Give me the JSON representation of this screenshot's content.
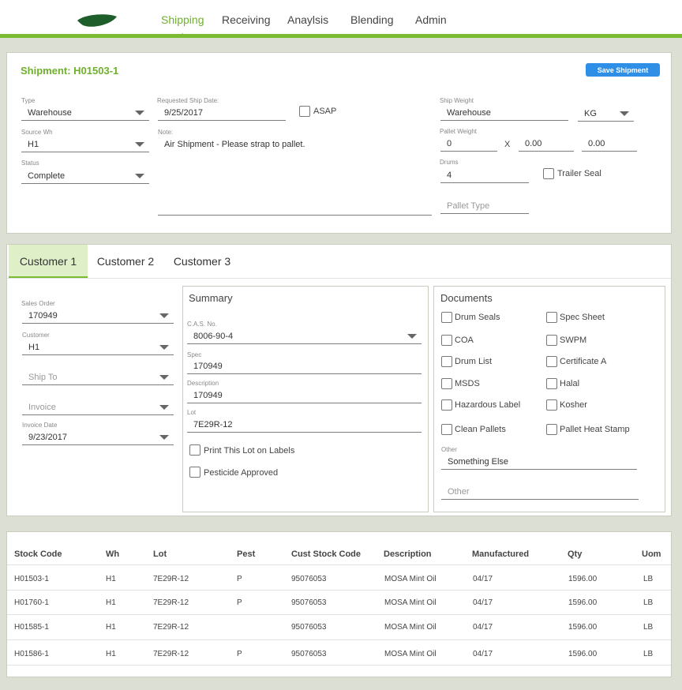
{
  "nav": {
    "items": [
      "Shipping",
      "Receiving",
      "Anaylsis",
      "Blending",
      "Admin"
    ],
    "active": "Shipping"
  },
  "shipment": {
    "title": "Shipment: H01503-1",
    "save_label": "Save Shipment",
    "type": {
      "label": "Type",
      "value": "Warehouse"
    },
    "source_wh": {
      "label": "Source Wh",
      "value": "H1"
    },
    "status": {
      "label": "Status",
      "value": "Complete"
    },
    "requested_ship_date": {
      "label": "Requested Ship Date:",
      "value": "9/25/2017"
    },
    "asap_label": "ASAP",
    "note": {
      "label": "Note:",
      "value": "Air Shipment - Please strap to pallet."
    },
    "ship_weight": {
      "label": "Ship Weight",
      "value": "Warehouse",
      "unit": "KG"
    },
    "pallet_weight": {
      "label": "Pallet Weight",
      "value": "0",
      "x_sep": "X",
      "dim1": "0.00",
      "dim2": "0.00"
    },
    "drums": {
      "label": "Drums",
      "value": "4"
    },
    "trailer_seal_label": "Trailer Seal",
    "pallet_type_placeholder": "Pallet Type"
  },
  "tabs": [
    "Customer 1",
    "Customer 2",
    "Customer 3"
  ],
  "customer": {
    "sales_order": {
      "label": "Sales Order",
      "value": "170949"
    },
    "customer": {
      "label": "Customer",
      "value": "H1"
    },
    "ship_to_placeholder": "Ship To",
    "invoice_placeholder": "Invoice",
    "invoice_date": {
      "label": "Invoice Date",
      "value": "9/23/2017"
    }
  },
  "summary": {
    "title": "Summary",
    "cas": {
      "label": "C.A.S. No.",
      "value": "8006-90-4"
    },
    "spec": {
      "label": "Spec",
      "value": "170949"
    },
    "description": {
      "label": "Description",
      "value": "170949"
    },
    "lot": {
      "label": "Lot",
      "value": "7E29R-12"
    },
    "print_lot_label": "Print This Lot on Labels",
    "pesticide_label": "Pesticide Approved"
  },
  "documents": {
    "title": "Documents",
    "left": [
      "Drum Seals",
      "COA",
      "Drum List",
      "MSDS",
      "Hazardous Label",
      "Clean Pallets"
    ],
    "right": [
      "Spec Sheet",
      "SWPM",
      "Certificate A",
      "Halal",
      "Kosher",
      "Pallet Heat Stamp"
    ],
    "other": {
      "label": "Other",
      "value": "Something Else"
    },
    "other_placeholder": "Other"
  },
  "stock_table": {
    "headers": [
      "Stock Code",
      "Wh",
      "Lot",
      "Pest",
      "Cust Stock Code",
      "Description",
      "Manufactured",
      "Qty",
      "Uom"
    ],
    "rows": [
      [
        "H01503-1",
        "H1",
        "7E29R-12",
        "P",
        "95076053",
        "MOSA Mint Oil",
        "04/17",
        "1596.00",
        "LB"
      ],
      [
        "H01760-1",
        "H1",
        "7E29R-12",
        "P",
        "95076053",
        "MOSA Mint Oil",
        "04/17",
        "1596.00",
        "LB"
      ],
      [
        "H01585-1",
        "H1",
        "7E29R-12",
        "",
        "95076053",
        "MOSA Mint Oil",
        "04/17",
        "1596.00",
        "LB"
      ],
      [
        "H01586-1",
        "H1",
        "7E29R-12",
        "P",
        "95076053",
        "MOSA Mint Oil",
        "04/17",
        "1596.00",
        "LB"
      ]
    ]
  },
  "colors": {
    "accent_green": "#7bbb31",
    "button_blue": "#2f8ee6"
  }
}
